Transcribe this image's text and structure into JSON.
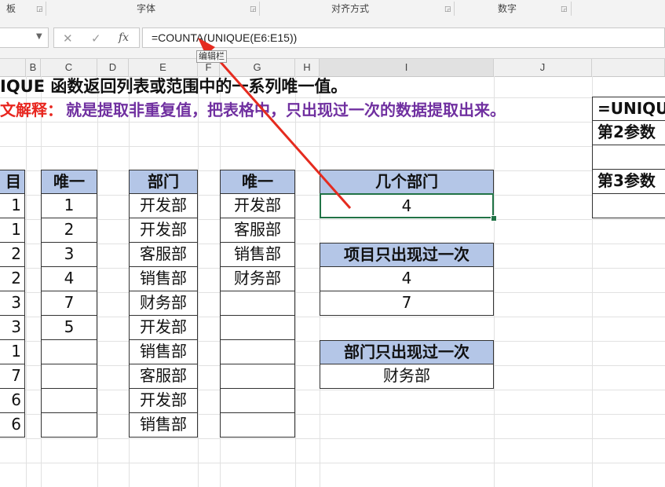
{
  "ribbon": {
    "groups": [
      "字体",
      "对齐方式",
      "数字"
    ],
    "launcher_icon": "dialog-launcher-icon",
    "partial_label_left": "板"
  },
  "formula_bar": {
    "formula": "=COUNTA(UNIQUE(E6:E15))",
    "tooltip": "编辑栏",
    "cancel_icon": "✕",
    "enter_icon": "✓",
    "fx_label": "fx"
  },
  "columns": [
    "B",
    "C",
    "D",
    "E",
    "F",
    "G",
    "H",
    "I",
    "J"
  ],
  "texts": {
    "row1": "IQUE 函数返回列表或范围中的一系列唯一值。",
    "row2_label": "文解释：",
    "row2_body": "就是提取非重复值，把表格中，只出现过一次的数据提取出来。",
    "right_top": "=UNIQU",
    "right_p2": "第2参数",
    "right_p3": "第3参数"
  },
  "left_table": {
    "header_partial": "目",
    "values_partial": [
      "1",
      "1",
      "2",
      "2",
      "3",
      "3",
      "1",
      "7",
      "6",
      "6"
    ]
  },
  "unique_col_c": {
    "header": "唯一",
    "values": [
      "1",
      "2",
      "3",
      "4",
      "7",
      "5",
      "",
      "",
      "",
      ""
    ]
  },
  "dept_col_e": {
    "header": "部门",
    "values": [
      "开发部",
      "开发部",
      "客服部",
      "销售部",
      "财务部",
      "开发部",
      "销售部",
      "客服部",
      "开发部",
      "销售部"
    ]
  },
  "unique_col_g": {
    "header": "唯一",
    "values": [
      "开发部",
      "客服部",
      "销售部",
      "财务部",
      "",
      "",
      "",
      "",
      "",
      ""
    ]
  },
  "box_count": {
    "header": "几个部门",
    "value": "4"
  },
  "box_once_item": {
    "header": "项目只出现过一次",
    "values": [
      "4",
      "7"
    ]
  },
  "box_once_dept": {
    "header": "部门只出现过一次",
    "values": [
      "财务部"
    ]
  },
  "colors": {
    "header_fill": "#b4c6e7",
    "red_label": "#e8261f",
    "purple_text": "#7030a0",
    "arrow": "#e52b1f",
    "selection": "#217346"
  }
}
